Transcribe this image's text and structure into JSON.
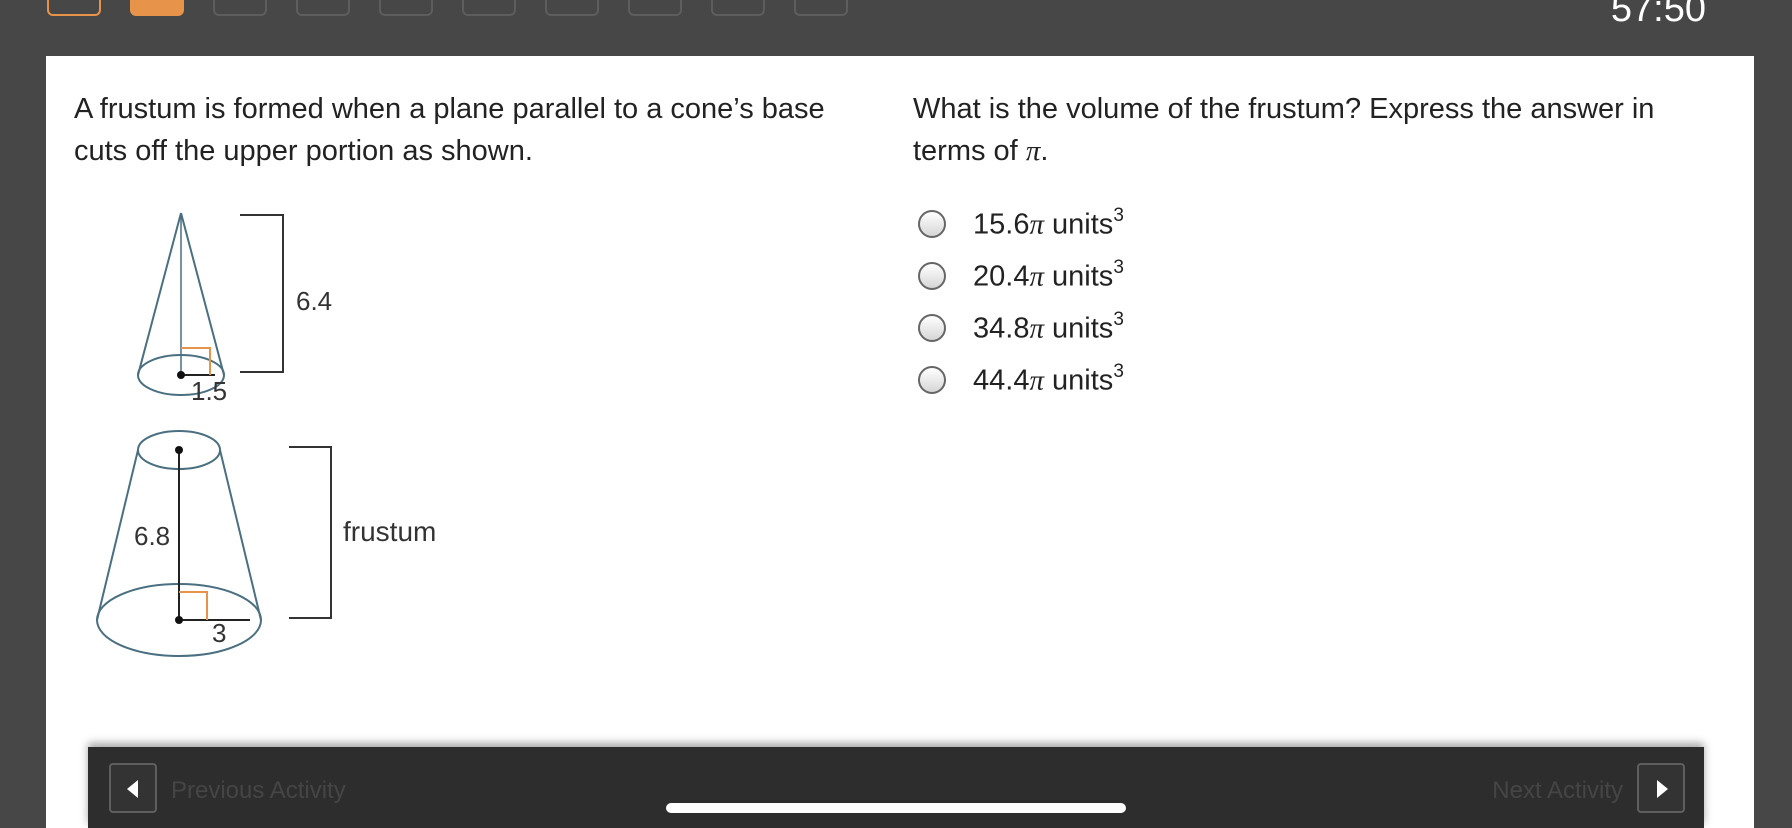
{
  "header": {
    "timer": "57:50",
    "question_nav": [
      {
        "state": "done"
      },
      {
        "state": "current"
      },
      {
        "state": "pending"
      },
      {
        "state": "pending"
      },
      {
        "state": "pending"
      },
      {
        "state": "pending"
      },
      {
        "state": "pending"
      },
      {
        "state": "pending"
      },
      {
        "state": "pending"
      },
      {
        "state": "pending"
      }
    ]
  },
  "prompt": {
    "left_text": "A frustum is formed when a plane parallel to a cone’s base cuts off the upper portion as shown.",
    "question_text": "What is the volume of the frustum? Express the answer in terms of ",
    "question_pi": "π",
    "question_end": "."
  },
  "figure": {
    "cone_height": "6.4",
    "cone_radius": "1.5",
    "slant_label": "6.8",
    "base_radius": "3",
    "frustum_label": "frustum"
  },
  "options": [
    {
      "number": "15.6",
      "pi": "π",
      "unit": " units",
      "exp": "3"
    },
    {
      "number": "20.4",
      "pi": "π",
      "unit": " units",
      "exp": "3"
    },
    {
      "number": "34.8",
      "pi": "π",
      "unit": " units",
      "exp": "3"
    },
    {
      "number": "44.4",
      "pi": "π",
      "unit": " units",
      "exp": "3"
    }
  ],
  "footer": {
    "prev_label": "Previous Activity",
    "next_label": "Next Activity"
  },
  "colors": {
    "accent": "#e8934a",
    "background": "#474747",
    "card": "#ffffff",
    "figure_stroke": "#4a6f80",
    "footer": "#2d2d2d"
  }
}
